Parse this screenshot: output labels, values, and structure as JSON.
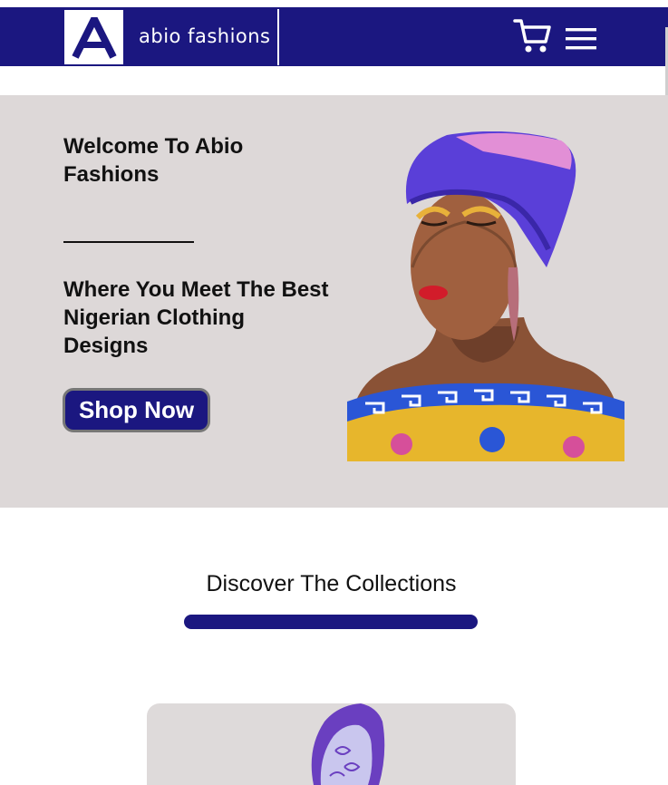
{
  "header": {
    "logo_letter": "A",
    "brand_name": "abio fashions",
    "cart_icon": "cart-icon",
    "menu_icon": "hamburger-menu-icon"
  },
  "hero": {
    "title": "Welcome To Abio Fashions",
    "subtitle": "Where You Meet The Best Nigerian Clothing Designs",
    "cta_label": "Shop Now",
    "image_alt": "woman-in-headwrap-image"
  },
  "collections": {
    "title": "Discover The Collections"
  },
  "colors": {
    "brand_navy": "#1b1780",
    "hero_bg": "#ddd8d8",
    "white": "#ffffff"
  }
}
